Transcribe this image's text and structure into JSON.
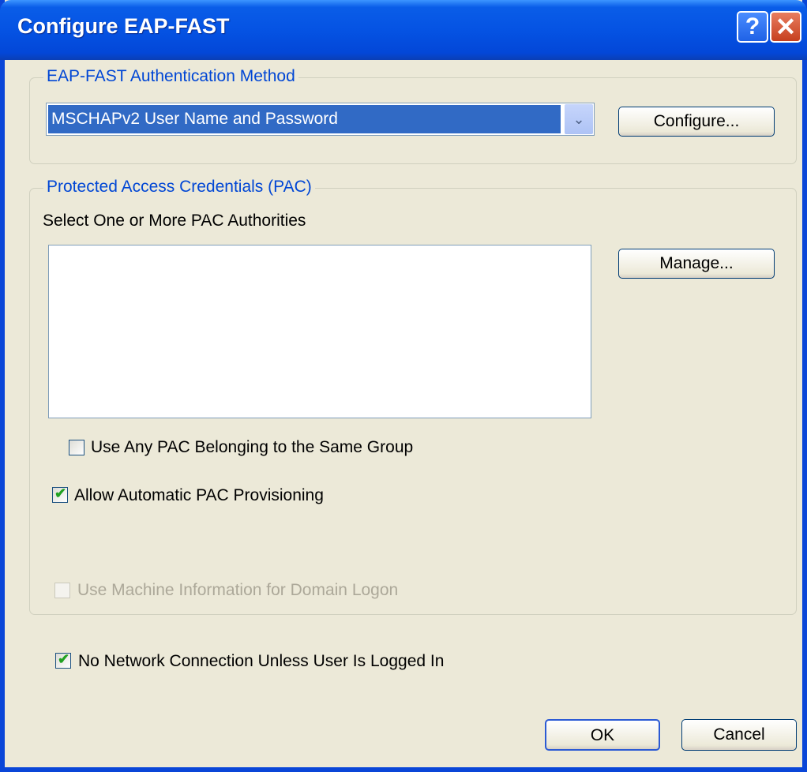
{
  "window": {
    "title": "Configure EAP-FAST",
    "help_glyph": "?",
    "close_glyph": "✕"
  },
  "auth_method": {
    "legend": "EAP-FAST Authentication Method",
    "selected": "MSCHAPv2 User Name and Password",
    "arrow_glyph": "⌄",
    "configure_label": "Configure..."
  },
  "pac": {
    "legend": "Protected Access Credentials (PAC)",
    "select_label": "Select One or More PAC Authorities",
    "manage_label": "Manage...",
    "authorities": [],
    "use_any_pac": {
      "label": "Use Any PAC Belonging to the Same Group",
      "checked": false
    },
    "auto_provision": {
      "label": "Allow Automatic PAC Provisioning",
      "checked": true
    },
    "machine_info": {
      "label": "Use Machine Information for Domain Logon",
      "checked": false,
      "enabled": false
    }
  },
  "no_network": {
    "label": "No Network Connection Unless User Is Logged In",
    "checked": true
  },
  "buttons": {
    "ok": "OK",
    "cancel": "Cancel"
  }
}
